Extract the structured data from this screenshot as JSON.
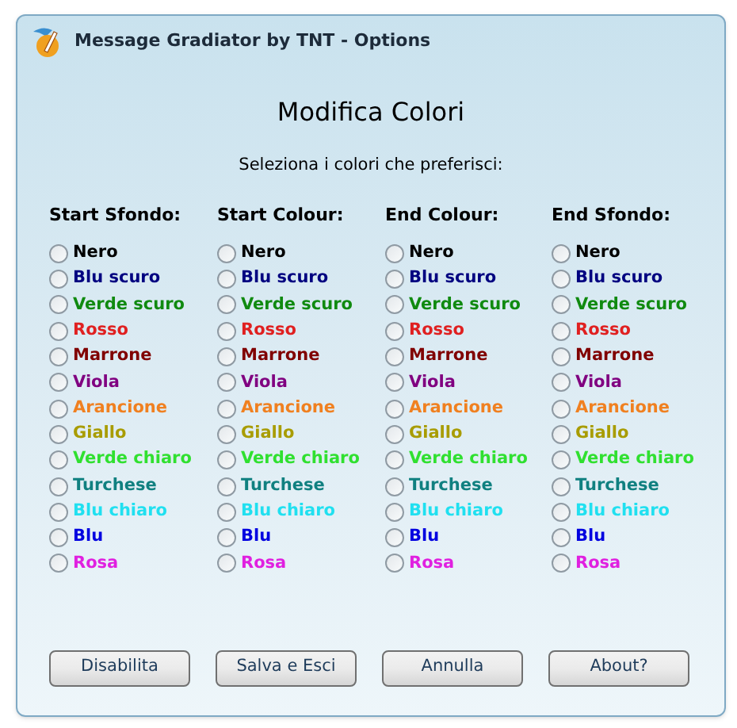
{
  "window": {
    "title": "Message Gradiator by TNT - Options"
  },
  "heading": "Modifica Colori",
  "subtitle": "Seleziona i colori che preferisci:",
  "columns": [
    {
      "title": "Start Sfondo:",
      "options": [
        {
          "label": "Nero",
          "color": "#000000",
          "selected": false
        },
        {
          "label": "Blu scuro",
          "color": "#000080",
          "selected": false
        },
        {
          "label": "Verde scuro",
          "color": "#108a10",
          "selected": false
        },
        {
          "label": "Rosso",
          "color": "#e02020",
          "selected": false
        },
        {
          "label": "Marrone",
          "color": "#800000",
          "selected": false
        },
        {
          "label": "Viola",
          "color": "#800080",
          "selected": false
        },
        {
          "label": "Arancione",
          "color": "#f08020",
          "selected": false
        },
        {
          "label": "Giallo",
          "color": "#a89c00",
          "selected": false
        },
        {
          "label": "Verde chiaro",
          "color": "#30e030",
          "selected": false
        },
        {
          "label": "Turchese",
          "color": "#108080",
          "selected": false
        },
        {
          "label": "Blu chiaro",
          "color": "#20e0f0",
          "selected": false
        },
        {
          "label": "Blu",
          "color": "#0000e0",
          "selected": false
        },
        {
          "label": "Rosa",
          "color": "#e020e0",
          "selected": false
        }
      ]
    },
    {
      "title": "Start Colour:",
      "options": [
        {
          "label": "Nero",
          "color": "#000000",
          "selected": false
        },
        {
          "label": "Blu scuro",
          "color": "#000080",
          "selected": false
        },
        {
          "label": "Verde scuro",
          "color": "#108a10",
          "selected": false
        },
        {
          "label": "Rosso",
          "color": "#e02020",
          "selected": false
        },
        {
          "label": "Marrone",
          "color": "#800000",
          "selected": false
        },
        {
          "label": "Viola",
          "color": "#800080",
          "selected": false
        },
        {
          "label": "Arancione",
          "color": "#f08020",
          "selected": false
        },
        {
          "label": "Giallo",
          "color": "#a89c00",
          "selected": false
        },
        {
          "label": "Verde chiaro",
          "color": "#30e030",
          "selected": false
        },
        {
          "label": "Turchese",
          "color": "#108080",
          "selected": false
        },
        {
          "label": "Blu chiaro",
          "color": "#20e0f0",
          "selected": false
        },
        {
          "label": "Blu",
          "color": "#0000e0",
          "selected": false
        },
        {
          "label": "Rosa",
          "color": "#e020e0",
          "selected": false
        }
      ]
    },
    {
      "title": "End Colour:",
      "options": [
        {
          "label": "Nero",
          "color": "#000000",
          "selected": false
        },
        {
          "label": "Blu scuro",
          "color": "#000080",
          "selected": false
        },
        {
          "label": "Verde scuro",
          "color": "#108a10",
          "selected": false
        },
        {
          "label": "Rosso",
          "color": "#e02020",
          "selected": false
        },
        {
          "label": "Marrone",
          "color": "#800000",
          "selected": false
        },
        {
          "label": "Viola",
          "color": "#800080",
          "selected": false
        },
        {
          "label": "Arancione",
          "color": "#f08020",
          "selected": false
        },
        {
          "label": "Giallo",
          "color": "#a89c00",
          "selected": false
        },
        {
          "label": "Verde chiaro",
          "color": "#30e030",
          "selected": false
        },
        {
          "label": "Turchese",
          "color": "#108080",
          "selected": false
        },
        {
          "label": "Blu chiaro",
          "color": "#20e0f0",
          "selected": false
        },
        {
          "label": "Blu",
          "color": "#0000e0",
          "selected": false
        },
        {
          "label": "Rosa",
          "color": "#e020e0",
          "selected": false
        }
      ]
    },
    {
      "title": "End Sfondo:",
      "options": [
        {
          "label": "Nero",
          "color": "#000000",
          "selected": false
        },
        {
          "label": "Blu scuro",
          "color": "#000080",
          "selected": false
        },
        {
          "label": "Verde scuro",
          "color": "#108a10",
          "selected": false
        },
        {
          "label": "Rosso",
          "color": "#e02020",
          "selected": false
        },
        {
          "label": "Marrone",
          "color": "#800000",
          "selected": false
        },
        {
          "label": "Viola",
          "color": "#800080",
          "selected": false
        },
        {
          "label": "Arancione",
          "color": "#f08020",
          "selected": false
        },
        {
          "label": "Giallo",
          "color": "#a89c00",
          "selected": false
        },
        {
          "label": "Verde chiaro",
          "color": "#30e030",
          "selected": false
        },
        {
          "label": "Turchese",
          "color": "#108080",
          "selected": false
        },
        {
          "label": "Blu chiaro",
          "color": "#20e0f0",
          "selected": false
        },
        {
          "label": "Blu",
          "color": "#0000e0",
          "selected": false
        },
        {
          "label": "Rosa",
          "color": "#e020e0",
          "selected": false
        }
      ]
    }
  ],
  "buttons": [
    "Disabilita",
    "Salva e Esci",
    "Annulla",
    "About?"
  ]
}
